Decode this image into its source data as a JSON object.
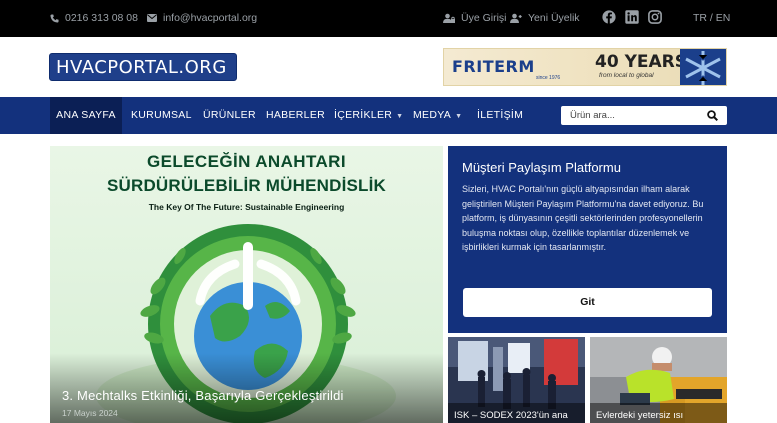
{
  "topbar": {
    "phone": "0216 313 08 08",
    "email": "info@hvacportal.org",
    "login": "Üye Girişi",
    "register": "Yeni Üyelik",
    "lang": "TR / EN"
  },
  "header": {
    "logo_text_a": "HVACPORTAL",
    "logo_text_b": ".ORG",
    "banner": {
      "brand": "FRITERM",
      "since": "since 1976",
      "years": "40 YEARS",
      "tagline": "from local to global"
    }
  },
  "nav": {
    "items": [
      "ANA SAYFA",
      "KURUMSAL",
      "ÜRÜNLER",
      "HABERLER",
      "İÇERİKLER",
      "MEDYA",
      "İLETİŞİM"
    ],
    "search_placeholder": "Ürün ara..."
  },
  "hero": {
    "headline_1": "GELECEĞİN ANAHTARI",
    "headline_2": "SÜRDÜRÜLEBİLİR MÜHENDİSLİK",
    "headline_3": "The Key Of The Future: Sustainable Engineering",
    "caption": "3. Mechtalks Etkinliği, Başarıyla Gerçekleştirildi",
    "date": "17 Mayıs 2024"
  },
  "platform": {
    "title": "Müşteri Paylaşım Platformu",
    "body": "Sizleri, HVAC Portalı'nın güçlü altyapısından ilham alarak geliştirilen Müşteri Paylaşım Platformu'na davet ediyoruz. Bu platform, iş dünyasının çeşitli sektörlerinden profesyonellerin buluşma noktası olup, özellikle toplantılar düzenlemek ve işbirlikleri kurmak için tasarlanmıştır.",
    "button": "Git"
  },
  "thumbs": [
    {
      "caption": "ISK – SODEX 2023'ün ana"
    },
    {
      "caption": "Evlerdeki yetersiz ısı"
    }
  ],
  "colors": {
    "nav_bg": "#13317d",
    "nav_active": "#0b1f55",
    "topbar_bg": "#000000",
    "brand_red": "#e21f26"
  }
}
